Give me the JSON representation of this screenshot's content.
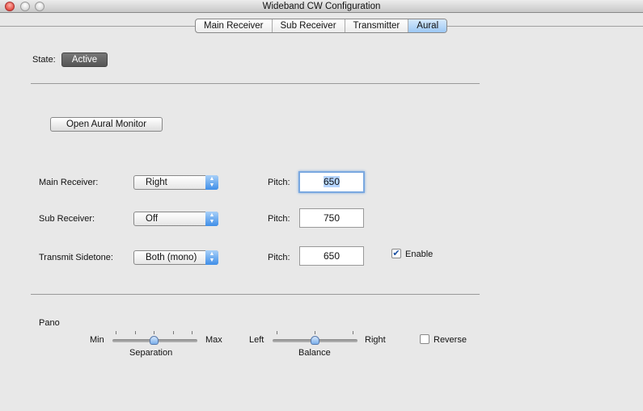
{
  "window": {
    "title": "Wideband CW Configuration"
  },
  "tabs": [
    {
      "label": "Main Receiver"
    },
    {
      "label": "Sub Receiver"
    },
    {
      "label": "Transmitter"
    },
    {
      "label": "Aural",
      "selected": true
    }
  ],
  "state": {
    "label": "State:",
    "value": "Active"
  },
  "open_monitor": "Open Aural Monitor",
  "rows": [
    {
      "label": "Main Receiver:",
      "select": "Right",
      "pitch_label": "Pitch:",
      "pitch": "650"
    },
    {
      "label": "Sub Receiver:",
      "select": "Off",
      "pitch_label": "Pitch:",
      "pitch": "750"
    },
    {
      "label": "Transmit Sidetone:",
      "select": "Both (mono)",
      "pitch_label": "Pitch:",
      "pitch": "650",
      "enable_label": "Enable",
      "enable_checked": true
    }
  ],
  "pano": {
    "title": "Pano",
    "separation": {
      "min": "Min",
      "max": "Max",
      "label": "Separation",
      "value": 0.5
    },
    "balance": {
      "min": "Left",
      "max": "Right",
      "label": "Balance",
      "value": 0.5
    },
    "reverse_label": "Reverse",
    "reverse_checked": false
  },
  "colors": {
    "accent": "#3f8ee8",
    "active_button": "#555555"
  }
}
